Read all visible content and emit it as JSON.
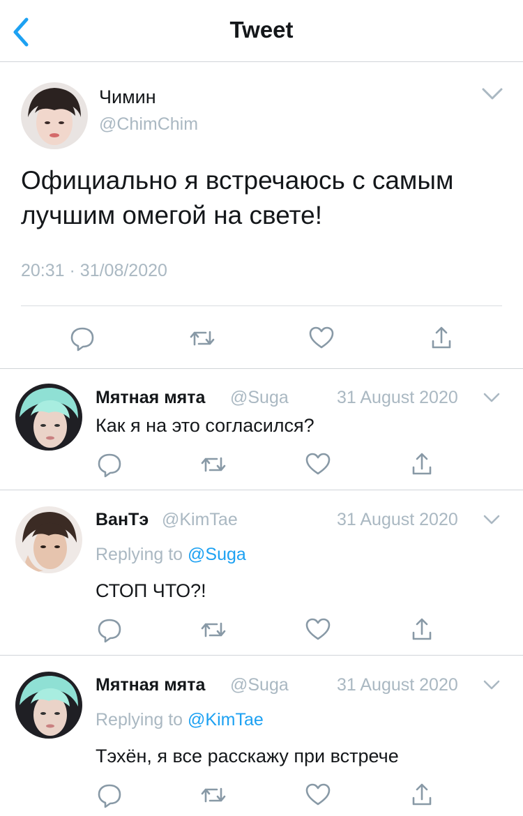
{
  "nav": {
    "title": "Tweet",
    "back_icon": "chevron-left-icon",
    "accent": "#1da1f2"
  },
  "main_tweet": {
    "author_name": "Чимин",
    "handle": "@ChimChim",
    "text": "Официально я встречаюсь с самым лучшим омегой на свете!",
    "time": "20:31",
    "separator": "·",
    "date": "31/08/2020"
  },
  "replies": [
    {
      "author_name": "Мятная мята",
      "handle": "@Suga",
      "date": "31 August 2020",
      "text": "Как я на это согласился?"
    },
    {
      "author_name": "ВанТэ",
      "handle": "@KimTae",
      "date": "31 August 2020",
      "replying_prefix": "Replying to",
      "replying_to": "@Suga",
      "text": "СТОП ЧТО?!"
    },
    {
      "author_name": "Мятная мята",
      "handle": "@Suga",
      "date": "31 August 2020",
      "replying_prefix": "Replying to",
      "replying_to": "@KimTae",
      "text": "Тэхён, я все расскажу при встрече"
    }
  ],
  "icons": [
    "reply-icon",
    "retweet-icon",
    "like-icon",
    "share-icon",
    "caret-down-icon"
  ],
  "colors": {
    "muted": "#aab8c2",
    "icon": "#8899a6",
    "link": "#1da1f2"
  }
}
